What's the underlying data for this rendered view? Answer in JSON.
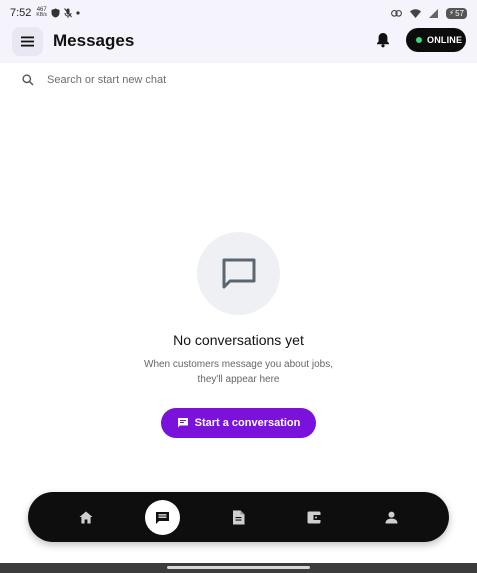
{
  "status_bar": {
    "time": "7:52",
    "net_speed": "467",
    "net_unit": "KB/s",
    "battery": "57"
  },
  "header": {
    "title": "Messages",
    "status_label": "ONLINE"
  },
  "search": {
    "placeholder": "Search or start new chat",
    "value": ""
  },
  "empty_state": {
    "title": "No conversations yet",
    "subtitle_line1": "When customers message you about jobs,",
    "subtitle_line2": "they'll appear here",
    "button_label": "Start a conversation"
  },
  "bottom_nav": {
    "items": [
      {
        "icon": "home-icon",
        "active": false
      },
      {
        "icon": "chat-icon",
        "active": true
      },
      {
        "icon": "document-icon",
        "active": false
      },
      {
        "icon": "wallet-icon",
        "active": false
      },
      {
        "icon": "profile-icon",
        "active": false
      }
    ]
  },
  "colors": {
    "accent": "#7a12dc",
    "online_dot": "#3ed67a",
    "nav_background": "#0e0e0e",
    "header_background": "#f5f3fb"
  }
}
